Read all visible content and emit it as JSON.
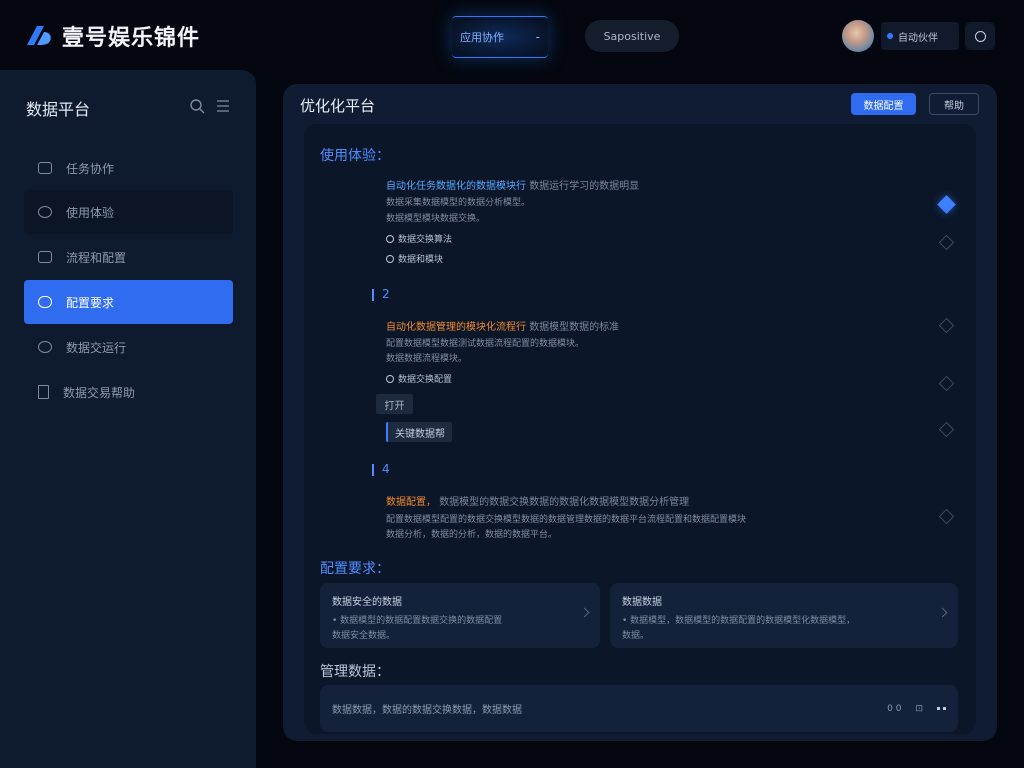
{
  "app": {
    "brand_name": "壹号娱乐锦件"
  },
  "top": {
    "tab_label": "应用协作",
    "tab_suffix": "-",
    "pill_label": "Sapositive",
    "user_label": "自动伙伴"
  },
  "sidebar": {
    "title": "数据平台",
    "items": [
      {
        "label": "任务协作",
        "icon": "folder-icon"
      },
      {
        "label": "使用体验",
        "icon": "settings-icon"
      },
      {
        "label": "流程和配置",
        "icon": "list-icon"
      },
      {
        "label": "配置要求",
        "icon": "cloud-icon"
      },
      {
        "label": "数据交运行",
        "icon": "clock-icon"
      },
      {
        "label": "数据交易帮助",
        "icon": "document-icon"
      }
    ]
  },
  "main": {
    "title": "优化化平台",
    "primary_button": "数据配置",
    "secondary_button": "帮助"
  },
  "content": {
    "section1_title": "使用体验：",
    "item1_head_blue": "自动化任务数据化的数据模块行",
    "item1_head_grey": "数据运行学习的数据明显",
    "item1_line1": "数据采集数据模型的数据分析模型。",
    "item1_line2": "数据模型模块数据交换。",
    "item1_check1": "数据交换算法",
    "item1_check2": "数据和模块",
    "item2_num": "2",
    "item2_head_orange": "自动化数据管理的模块化流程行",
    "item2_head_grey": "数据模型数据的标准",
    "item2_line1": "配置数据模型数据测试数据流程配置的数据模块。",
    "item2_line2": "数据数据流程模块。",
    "item2_check1": "数据交换配置",
    "tag1": "打开",
    "tag2": "关键数据帮",
    "item3_num": "4",
    "item3_head_orange": "数据配置，",
    "item3_head_grey": "数据模型的数据交换数据的数据化数据模型数据分析管理",
    "item3_line1": "配置数据模型配置的数据交换模型数据的数据管理数据的数据平台流程配置和数据配置模块",
    "item3_line2": "数据分析，数据的分析，数据的数据平台。",
    "section2_title": "配置要求：",
    "card1_title": "数据安全的数据",
    "card1_desc1": "• 数据模型的数据配置数据交换的数据配置",
    "card1_desc2": "数据安全数据。",
    "card2_title": "数据数据",
    "card2_desc1": "• 数据模型，数据模型的数据配置的数据模型化数据模型，",
    "card2_desc2": "数据。",
    "section3_title": "管理数据：",
    "footer_text": "数据数据，数据的数据交换数据，数据数据",
    "footer_icon1": "0 0",
    "footer_icon2": "⊡"
  }
}
